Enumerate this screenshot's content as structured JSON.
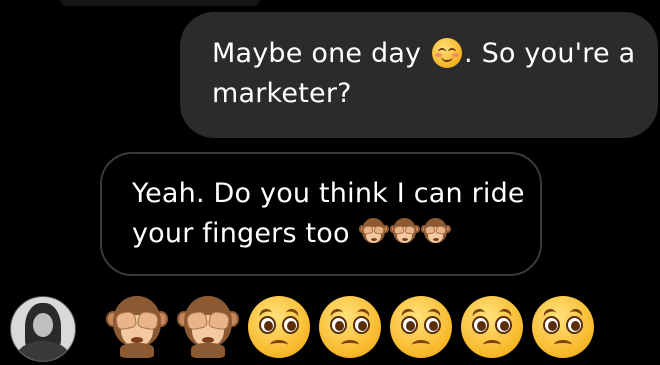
{
  "conversation": {
    "messages": [
      {
        "direction": "outgoing",
        "line1_before": "Maybe one day ",
        "line1_emoji": "smiling-face-with-blush-icon",
        "line1_after": ". So you're a",
        "line2": "marketer?"
      },
      {
        "direction": "incoming",
        "line1": "Yeah. Do you think I can ride",
        "line2_text": "your fingers too ",
        "line2_emojis": [
          "see-no-evil-monkey-icon",
          "see-no-evil-monkey-icon",
          "see-no-evil-monkey-icon"
        ]
      },
      {
        "direction": "outgoing-emoji-only",
        "emojis": [
          "see-no-evil-monkey-icon",
          "see-no-evil-monkey-icon",
          "pleading-face-icon",
          "pleading-face-icon",
          "pleading-face-icon",
          "pleading-face-icon",
          "pleading-face-icon"
        ]
      }
    ]
  },
  "colors": {
    "background": "#000000",
    "outgoing_bubble": "#2b2b2b",
    "incoming_border": "#3a3a3a",
    "text": "#ffffff"
  }
}
